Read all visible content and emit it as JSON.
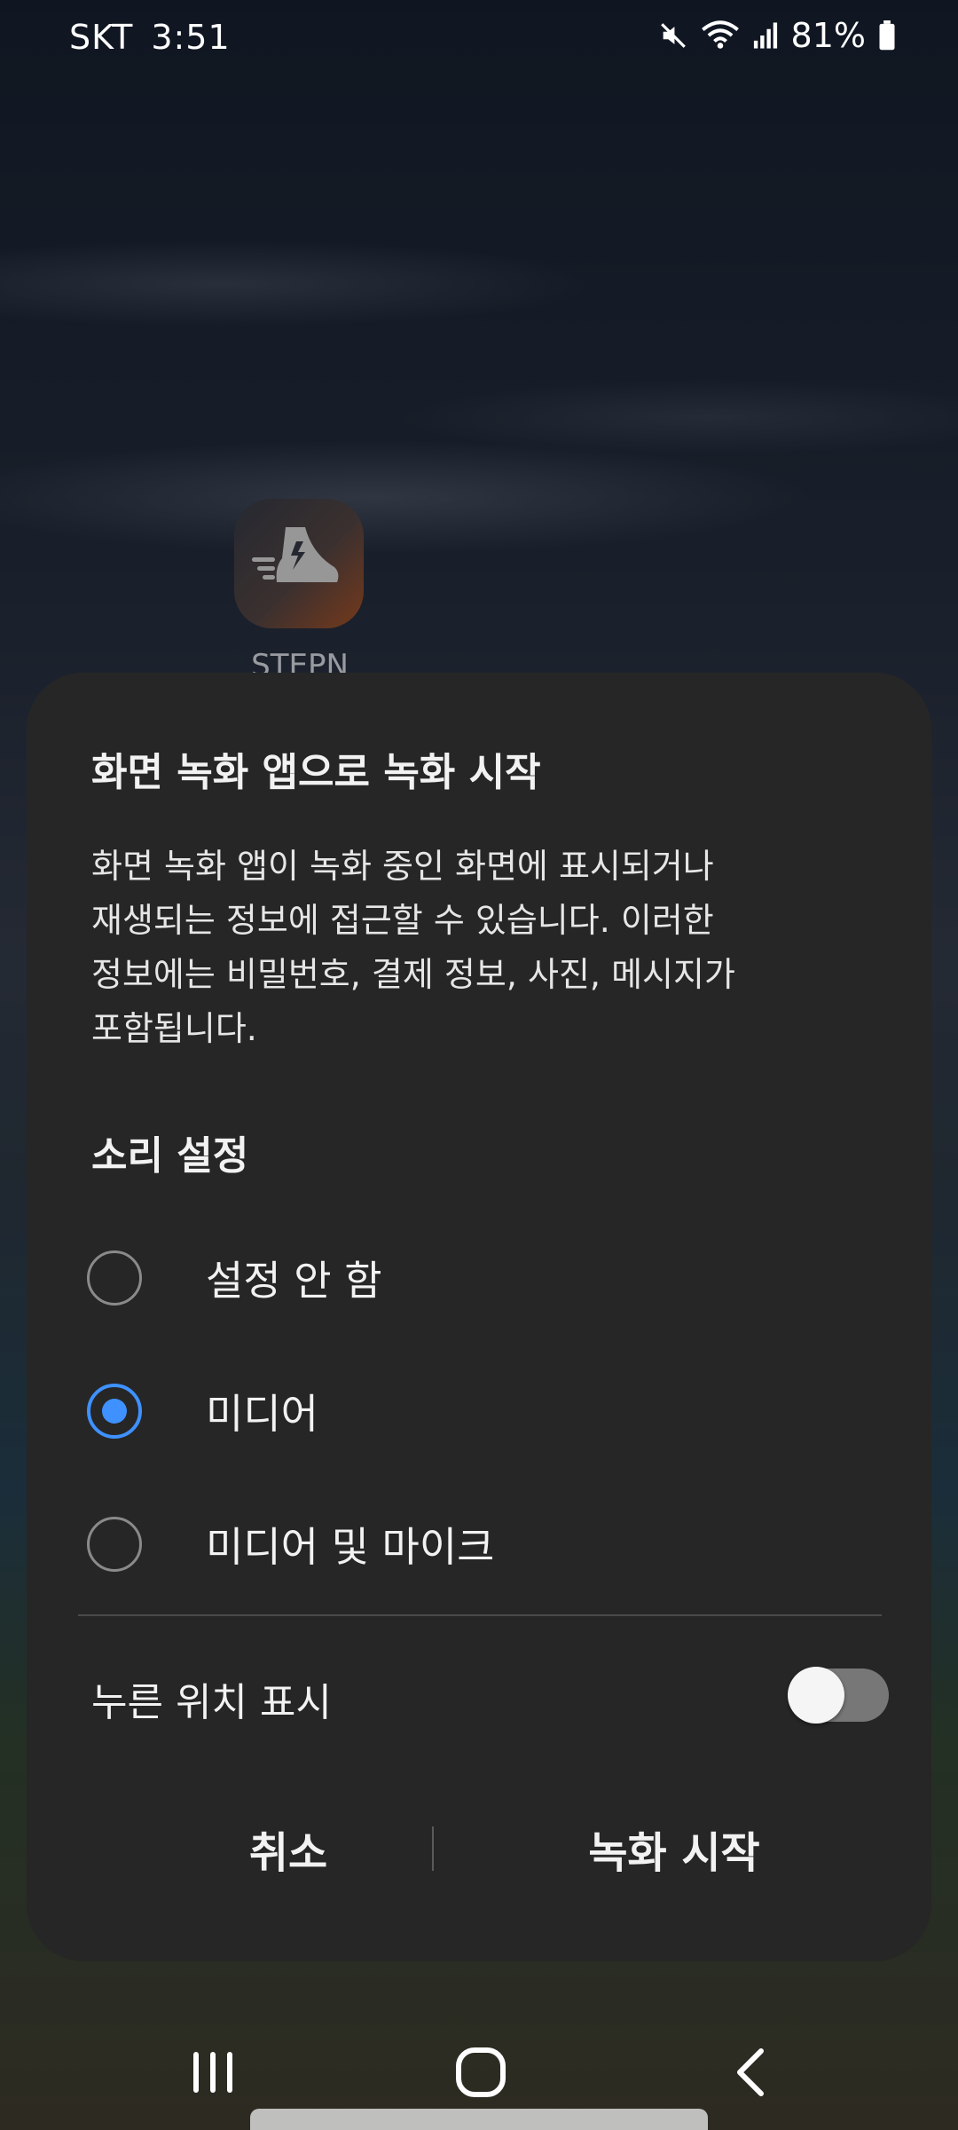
{
  "status_bar": {
    "carrier": "SKT",
    "time": "3:51",
    "battery": "81%",
    "icons": [
      "mute-icon",
      "wifi-icon",
      "signal-icon",
      "battery-icon"
    ]
  },
  "home": {
    "app_label": "STEPN"
  },
  "dialog": {
    "title": "화면 녹화 앱으로 녹화 시작",
    "body_lines": [
      "화면 녹화 앱이 녹화 중인 화면에 표시되거나",
      "재생되는 정보에 접근할 수 있습니다. 이러한",
      "정보에는 비밀번호, 결제 정보, 사진, 메시지가",
      "포함됩니다."
    ],
    "sound_section_title": "소리 설정",
    "sound_options": [
      {
        "label": "설정 안 함",
        "selected": false
      },
      {
        "label": "미디어",
        "selected": true
      },
      {
        "label": "미디어 및 마이크",
        "selected": false
      }
    ],
    "show_taps_label": "누른 위치 표시",
    "show_taps_enabled": false,
    "cancel_label": "취소",
    "start_label": "녹화 시작"
  },
  "colors": {
    "accent": "#3e91ff",
    "dialog_bg": "#262626"
  },
  "nav_bar": {
    "icons": [
      "recent-apps-icon",
      "home-icon",
      "back-icon"
    ]
  }
}
